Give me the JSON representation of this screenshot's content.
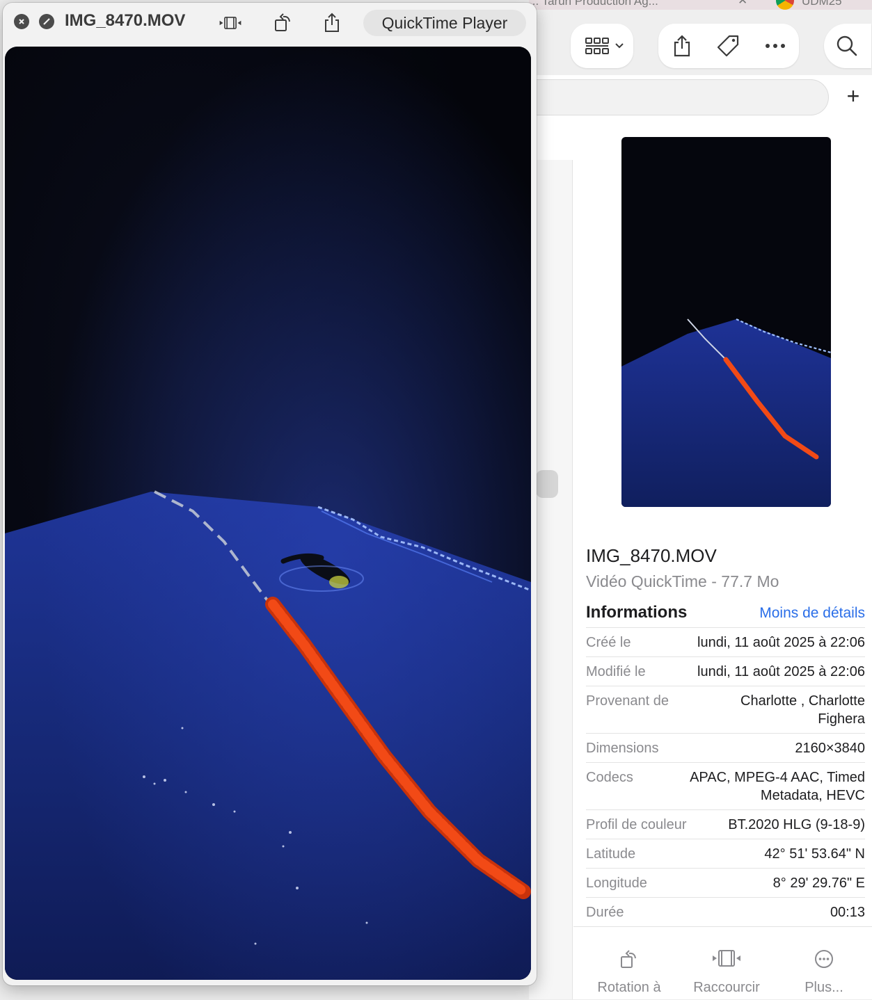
{
  "colors": {
    "accent_link": "#2a6ee8",
    "secondary_text": "#8a8a8e",
    "primary_text": "#1d1d1f",
    "video_dark": "#05060d",
    "water_blue": "#1b2c7c",
    "buoy_line_orange": "#f24a16"
  },
  "background_tabs": {
    "left_text": "... Tarun Production   Ag...",
    "close_glyph": "✕",
    "right_text": "UDM25"
  },
  "finder_toolbar": {
    "icons": [
      "grid-view-icon",
      "chevron-down-icon",
      "share-icon",
      "tag-icon",
      "more-icon",
      "search-icon"
    ],
    "plus_glyph": "+"
  },
  "quicktime": {
    "file_name": "IMG_8470.MOV",
    "app_name": "QuickTime Player",
    "icons": [
      "close-icon",
      "minimize-icon",
      "trim-icon",
      "rotate-icon",
      "share-icon"
    ]
  },
  "preview": {
    "file_name": "IMG_8470.MOV",
    "file_kind": "Vidéo QuickTime - 77.7 Mo",
    "info_title": "Informations",
    "less_details": "Moins de détails",
    "rows": [
      {
        "label": "Créé le",
        "value": "lundi, 11 août 2025 à 22:06"
      },
      {
        "label": "Modifié le",
        "value": "lundi, 11 août 2025 à 22:06"
      },
      {
        "label": "Provenant de",
        "value": "Charlotte , Charlotte Fighera"
      },
      {
        "label": "Dimensions",
        "value": "2160×3840"
      },
      {
        "label": "Codecs",
        "value": "APAC, MPEG-4 AAC, Timed Metadata, HEVC"
      },
      {
        "label": "Profil de couleur",
        "value": "BT.2020 HLG (9-18-9)"
      },
      {
        "label": "Latitude",
        "value": "42° 51' 53.64\" N"
      },
      {
        "label": "Longitude",
        "value": "8° 29' 29.76\" E"
      },
      {
        "label": "Durée",
        "value": "00:13"
      }
    ],
    "actions": [
      {
        "label": "Rotation à",
        "icon": "rotate-left-icon"
      },
      {
        "label": "Raccourcir",
        "icon": "trim-icon"
      },
      {
        "label": "Plus...",
        "icon": "more-circle-icon"
      }
    ]
  }
}
